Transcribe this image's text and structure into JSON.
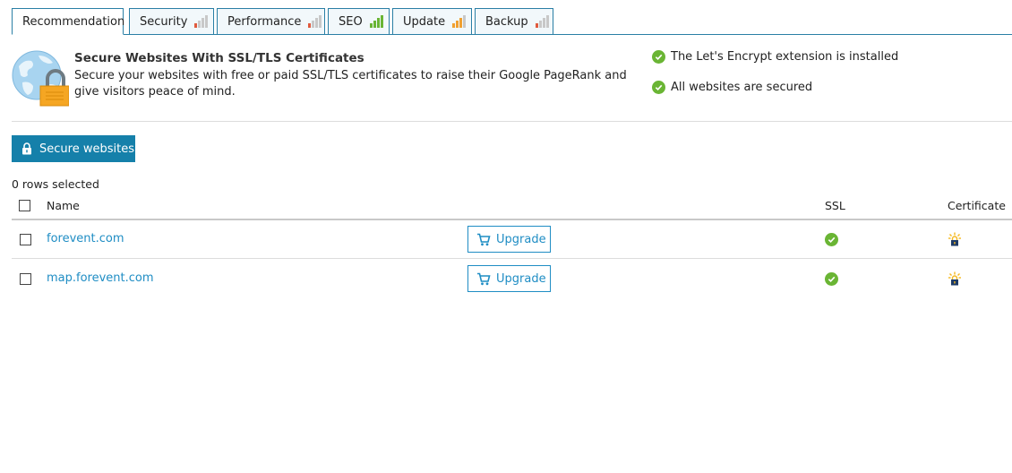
{
  "tabs": [
    {
      "label": "Recommendation",
      "active": true
    },
    {
      "label": "Security",
      "bars": [
        "#e05a3e",
        "#c8c8c8",
        "#c8c8c8",
        "#c8c8c8"
      ]
    },
    {
      "label": "Performance",
      "bars": [
        "#e05a3e",
        "#c8c8c8",
        "#c8c8c8",
        "#c8c8c8"
      ]
    },
    {
      "label": "SEO",
      "bars": [
        "#6ab534",
        "#6ab534",
        "#6ab534",
        "#6ab534"
      ]
    },
    {
      "label": "Update",
      "bars": [
        "#f0a030",
        "#f0a030",
        "#f0a030",
        "#c8c8c8"
      ]
    },
    {
      "label": "Backup",
      "bars": [
        "#e05a3e",
        "#c8c8c8",
        "#c8c8c8",
        "#c8c8c8"
      ]
    }
  ],
  "recommendation": {
    "title": "Secure Websites With SSL/TLS Certificates",
    "description": "Secure your websites with free or paid SSL/TLS certificates to raise their Google PageRank and give visitors peace of mind.",
    "statuses": [
      "The Let's Encrypt extension is installed",
      "All websites are secured"
    ]
  },
  "actions": {
    "secure_label": "Secure websites"
  },
  "table": {
    "rows_selected": "0 rows selected",
    "columns": {
      "name": "Name",
      "ssl": "SSL",
      "certificate": "Certificate"
    },
    "rows": [
      {
        "name": "forevent.com",
        "action": "Upgrade",
        "ssl": "secured"
      },
      {
        "name": "map.forevent.com",
        "action": "Upgrade",
        "ssl": "secured"
      }
    ]
  },
  "colors": {
    "accent": "#1580aa",
    "link": "#1f8dc4",
    "ok": "#6ab534"
  }
}
